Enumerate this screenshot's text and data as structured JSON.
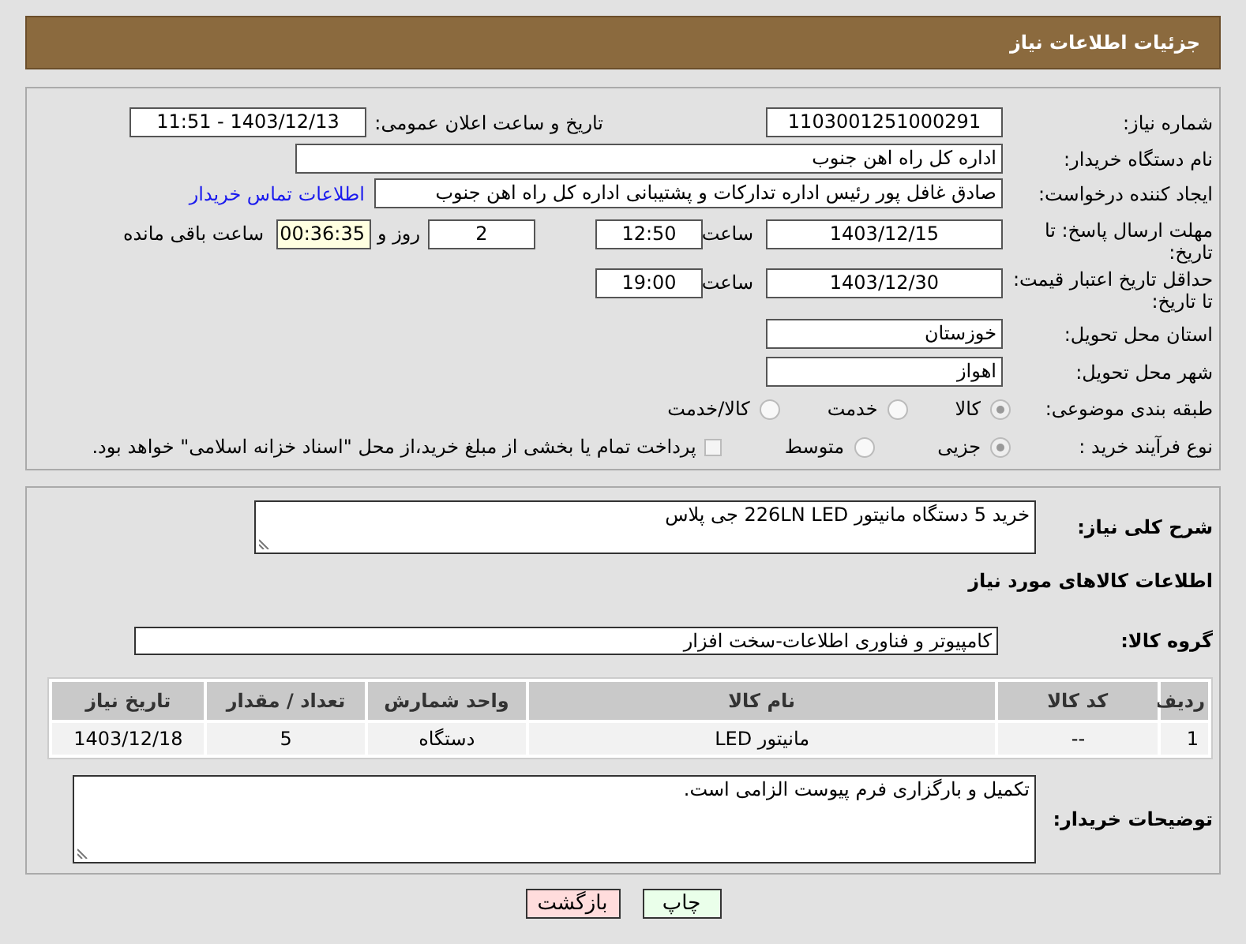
{
  "header": {
    "title": "جزئیات اطلاعات نیاز"
  },
  "need_number": {
    "label": "شماره نیاز:",
    "value": "1103001251000291"
  },
  "announce": {
    "label": "تاریخ و ساعت اعلان عمومی:",
    "value": "1403/12/13 - 11:51"
  },
  "buyer": {
    "label": "نام دستگاه خریدار:",
    "value": "اداره کل راه اهن جنوب"
  },
  "requester": {
    "label": "ایجاد کننده درخواست:",
    "value": "صادق غافل پور رئیس اداره تدارکات و پشتیبانی اداره کل راه اهن جنوب",
    "link": "اطلاعات تماس خریدار"
  },
  "deadline": {
    "label": "مهلت ارسال پاسخ: تا تاریخ:",
    "date": "1403/12/15",
    "time_label": "ساعت",
    "time": "12:50",
    "days": "2",
    "days_label": "روز و",
    "remaining": "00:36:35",
    "remaining_label": "ساعت باقی مانده"
  },
  "validity": {
    "label": "حداقل تاریخ اعتبار قیمت: تا تاریخ:",
    "date": "1403/12/30",
    "time_label": "ساعت",
    "time": "19:00"
  },
  "province": {
    "label": "استان محل تحویل:",
    "value": "خوزستان"
  },
  "city": {
    "label": "شهر محل تحویل:",
    "value": "اهواز"
  },
  "category": {
    "label": "طبقه بندی موضوعی:",
    "options": [
      {
        "label": "کالا",
        "selected": true
      },
      {
        "label": "خدمت",
        "selected": false
      },
      {
        "label": "کالا/خدمت",
        "selected": false
      }
    ]
  },
  "process": {
    "label": "نوع فرآیند خرید :",
    "options": [
      {
        "label": "جزیی",
        "selected": true
      },
      {
        "label": "متوسط",
        "selected": false
      }
    ],
    "payment": {
      "label": "پرداخت تمام یا بخشی از مبلغ خرید،از محل \"اسناد خزانه اسلامی\" خواهد بود.",
      "checked": false
    }
  },
  "description": {
    "label": "شرح کلی نیاز:",
    "value": "خرید 5 دستگاه مانیتور 226LN LED جی پلاس"
  },
  "goods_title": "اطلاعات کالاهای مورد نیاز",
  "group": {
    "label": "گروه کالا:",
    "value": "کامپیوتر و فناوری اطلاعات-سخت افزار"
  },
  "table": {
    "columns": [
      "ردیف",
      "کد کالا",
      "نام کالا",
      "واحد شمارش",
      "تعداد / مقدار",
      "تاریخ نیاز"
    ],
    "rows": [
      [
        "1",
        "--",
        "مانیتور LED",
        "دستگاه",
        "5",
        "1403/12/18"
      ]
    ]
  },
  "buyer_notes": {
    "label": "توضیحات خریدار:",
    "value": "تکمیل و بارگزاری فرم پیوست الزامی است."
  },
  "buttons": [
    {
      "label": "چاپ",
      "kind": "print"
    },
    {
      "label": "بازگشت",
      "kind": "back"
    }
  ]
}
